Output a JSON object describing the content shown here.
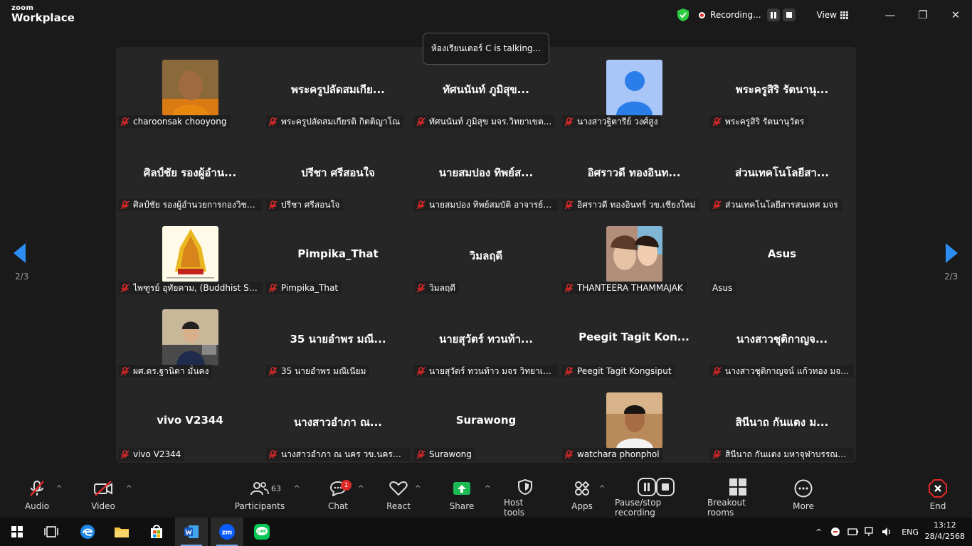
{
  "app": {
    "logo_line1": "zoom",
    "logo_line2": "Workplace"
  },
  "titlebar": {
    "recording": "Recording...",
    "view": "View"
  },
  "toast": "ห้องเรียนเตอร์ C is talking...",
  "pagination": {
    "left": "2/3",
    "right": "2/3"
  },
  "participants": [
    {
      "big": "",
      "label": "charoonsak chooyong",
      "photo": "monk"
    },
    {
      "big": "พระครูปลัดสมเกีย...",
      "label": "พระครูปลัดสมเกียรติ กิตติญาโณ",
      "photo": ""
    },
    {
      "big": "ทัศนนันท์  ภูมิสุข...",
      "label": "ทัศนนันท์  ภูมิสุข   มจร.วิทยาเขต...",
      "photo": ""
    },
    {
      "big": "",
      "label": "นางสาวฐิตารีย์ วงศ์สูง",
      "photo": "avatar"
    },
    {
      "big": "พระครูสิริ รัตนานุ...",
      "label": "พระครูสิริ รัตนานุวัตร",
      "photo": ""
    },
    {
      "big": "ศิลป์ชัย  รองผู้อำน...",
      "label": "ศิลป์ชัย  รองผู้อำนวยการกองวิชาการ",
      "photo": ""
    },
    {
      "big": "ปรีชา  ศรีสอนใจ",
      "label": "ปรีชา  ศรีสอนใจ",
      "photo": ""
    },
    {
      "big": "นายสมปอง ทิพย์ส...",
      "label": "นายสมปอง ทิพย์สมบัติ อาจารย์ปรัชญ...",
      "photo": ""
    },
    {
      "big": "อิศราวดี ทองอินท...",
      "label": "อิศราวดี ทองอินทร์ วข.เชียงใหม่",
      "photo": ""
    },
    {
      "big": "ส่วนเทคโนโลยีสา...",
      "label": "ส่วนเทคโนโลยีสารสนเทศ มจร",
      "photo": ""
    },
    {
      "big": "",
      "label": "ไพฑูรย์ อุทัยคาม, (Buddhist Stud...",
      "photo": "logo"
    },
    {
      "big": "Pimpika_That",
      "label": "Pimpika_That",
      "photo": ""
    },
    {
      "big": "วิมลฤดี",
      "label": "วิมลฤดี",
      "photo": ""
    },
    {
      "big": "",
      "label": "THANTEERA THAMMAJAK",
      "photo": "friends",
      "muted": true
    },
    {
      "big": "Asus",
      "label": "Asus",
      "photo": "",
      "nomic": true
    },
    {
      "big": "",
      "label": "ผศ.ดร.ฐานิดา มั่นคง",
      "photo": "office"
    },
    {
      "big": "35 นายอำพร  มณี...",
      "label": "35 นายอำพร  มณีเนียม",
      "photo": ""
    },
    {
      "big": "นายสุวัตร์  ทวนท้า...",
      "label": "นายสุวัตร์  ทวนท้าว มจร วิทยาเขต...",
      "photo": ""
    },
    {
      "big": "Peegit Tagit Kon...",
      "label": "Peegit Tagit Kongsiput",
      "photo": ""
    },
    {
      "big": "นางสาวชุติกาญจ...",
      "label": "นางสาวชุติกาญจน์  แก้วทอง  มจร....",
      "photo": ""
    },
    {
      "big": "vivo V2344",
      "label": "vivo V2344",
      "photo": ""
    },
    {
      "big": "นางสาวอำภา  ณ...",
      "label": "นางสาวอำภา  ณ นคร วข.นครศรีฯ",
      "photo": ""
    },
    {
      "big": "Surawong",
      "label": "Surawong",
      "photo": ""
    },
    {
      "big": "",
      "label": "watchara phonphol",
      "photo": "boy"
    },
    {
      "big": "สินีนาถ  กันแตง ม...",
      "label": "สินีนาถ  กันแตง มหาจุฬาบรรณาคาร",
      "photo": ""
    }
  ],
  "toolbar": {
    "audio": "Audio",
    "video": "Video",
    "participants": "Participants",
    "participants_count": "63",
    "chat": "Chat",
    "chat_badge": "1",
    "react": "React",
    "share": "Share",
    "host_tools": "Host tools",
    "apps": "Apps",
    "pause_recording": "Pause/stop recording",
    "breakout": "Breakout rooms",
    "more": "More",
    "end": "End"
  },
  "taskbar": {
    "lang": "ENG",
    "time": "13:12",
    "date": "28/4/2568"
  },
  "colors": {
    "accent": "#2b8cf2",
    "share": "#1db954",
    "end": "#e02828"
  }
}
